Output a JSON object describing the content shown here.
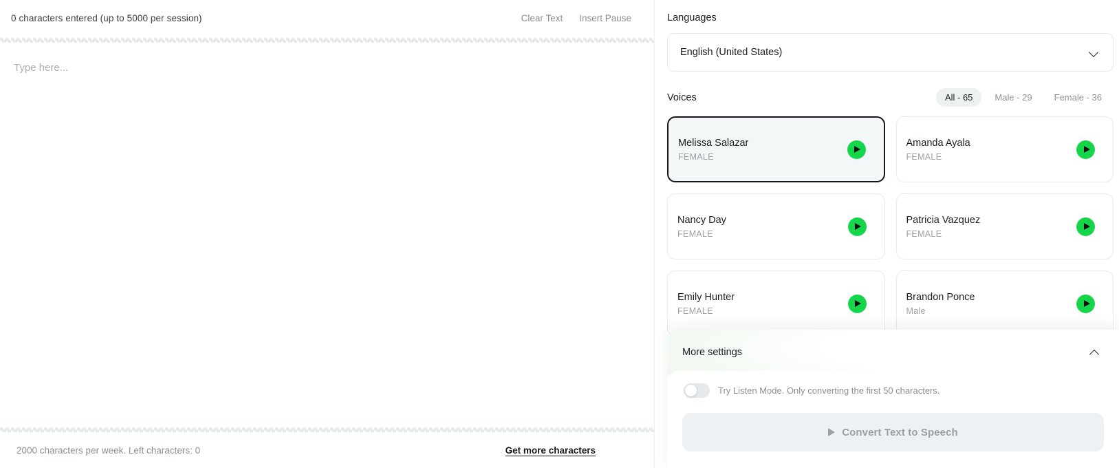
{
  "editor": {
    "char_counter": "0 characters entered (up to 5000 per session)",
    "clear_text_label": "Clear Text",
    "insert_pause_label": "Insert Pause",
    "placeholder": "Type here...",
    "input_value": "",
    "quota_text": "2000 characters per week. Left characters: 0",
    "get_more_label": "Get more characters"
  },
  "languages": {
    "label": "Languages",
    "selected": "English (United States)"
  },
  "voices": {
    "label": "Voices",
    "filters": [
      {
        "label": "All - 65",
        "active": true
      },
      {
        "label": "Male - 29",
        "active": false
      },
      {
        "label": "Female - 36",
        "active": false
      }
    ],
    "cards": [
      {
        "name": "Melissa Salazar",
        "gender": "FEMALE",
        "selected": true
      },
      {
        "name": "Amanda Ayala",
        "gender": "FEMALE",
        "selected": false
      },
      {
        "name": "Nancy Day",
        "gender": "FEMALE",
        "selected": false
      },
      {
        "name": "Patricia Vazquez",
        "gender": "FEMALE",
        "selected": false
      },
      {
        "name": "Emily Hunter",
        "gender": "FEMALE",
        "selected": false
      },
      {
        "name": "Brandon Ponce",
        "gender": "Male",
        "selected": false
      }
    ]
  },
  "more_settings": {
    "title": "More settings",
    "listen_mode_text": "Try Listen Mode. Only converting the first 50 characters.",
    "listen_mode_on": false,
    "convert_label": "Convert Text to Speech",
    "convert_enabled": false
  },
  "colors": {
    "accent_green": "#15d64a",
    "pill_active_bg": "#edf2ee",
    "selected_card_border": "#15181b",
    "selected_card_bg": "#f3f7f8"
  }
}
